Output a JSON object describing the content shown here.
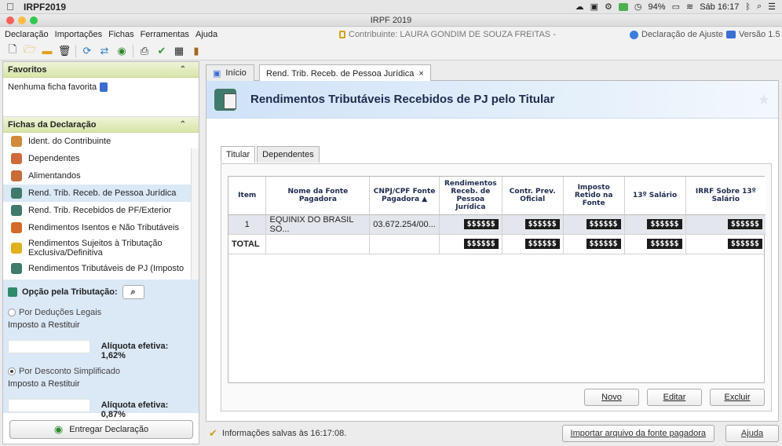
{
  "mac": {
    "app_name": "IRPF2019",
    "battery": "94%",
    "clock": "Sáb 16:17"
  },
  "window": {
    "title": "IRPF 2019"
  },
  "menu": {
    "items": [
      "Declaração",
      "Importações",
      "Fichas",
      "Ferramentas",
      "Ajuda"
    ],
    "contribuinte": "Contribuinte: LAURA GONDIM DE SOUZA FREITAS -",
    "declaracao": "Declaração de Ajuste",
    "versao": "Versão 1.5"
  },
  "favoritos": {
    "header": "Favoritos",
    "empty": "Nenhuma ficha favorita"
  },
  "fichas": {
    "header": "Fichas da Declaração",
    "items": [
      {
        "label": "Ident. do Contribuinte",
        "color": "#d08a3a"
      },
      {
        "label": "Dependentes",
        "color": "#d06a3a"
      },
      {
        "label": "Alimentandos",
        "color": "#c96b37"
      },
      {
        "label": "Rend. Trib. Receb. de Pessoa Jurídica",
        "color": "#3f7a6a"
      },
      {
        "label": "Rend. Trib. Recebidos de PF/Exterior",
        "color": "#3f7a6a"
      },
      {
        "label": "Rendimentos Isentos e Não Tributáveis",
        "color": "#d46a2a"
      },
      {
        "label": "Rendimentos Sujeitos à Tributação Exclusiva/Definitiva",
        "color": "#e0b020"
      },
      {
        "label": "Rendimentos Tributáveis de PJ (Imposto",
        "color": "#3f7a6a"
      }
    ],
    "selected_index": 3
  },
  "opcao": {
    "header": "Opção pela Tributação:",
    "deducoes": "Por Deduções Legais",
    "restituir1": "Imposto a Restituir",
    "aliquota1": "Alíquota efetiva: 1,62%",
    "simplificado": "Por Desconto Simplificado",
    "restituir2": "Imposto a Restituir",
    "aliquota2": "Alíquota efetiva: 0,87%"
  },
  "entregar": "Entregar Declaração",
  "tabs": {
    "inicio": "Início",
    "current": "Rend. Trib. Receb. de Pessoa Jurídica",
    "close": "×"
  },
  "page_title": "Rendimentos Tributáveis Recebidos de PJ pelo Titular",
  "subtabs": [
    "Titular",
    "Dependentes"
  ],
  "table": {
    "headers": [
      "Item",
      "Nome da Fonte Pagadora",
      "CNPJ/CPF Fonte Pagadora",
      "Rendimentos Receb. de Pessoa Jurídica",
      "Contr. Prev. Oficial",
      "Imposto Retido na Fonte",
      "13º Salário",
      "IRRF Sobre 13º Salário"
    ],
    "rows": [
      [
        "1",
        "EQUINIX DO BRASIL SO...",
        "03.672.254/00...",
        "$$$$$$",
        "$$$$$$",
        "$$$$$$",
        "$$$$$$",
        "$$$$$$"
      ]
    ],
    "total": [
      "TOTAL",
      "",
      "",
      "$$$$$$",
      "$$$$$$",
      "$$$$$$",
      "$$$$$$",
      "$$$$$$"
    ]
  },
  "buttons": {
    "novo": "Novo",
    "editar": "Editar",
    "excluir": "Excluir",
    "importar": "Importar arquivo da fonte pagadora",
    "ajuda": "Ajuda"
  },
  "status": "Informações salvas às 16:17:08."
}
